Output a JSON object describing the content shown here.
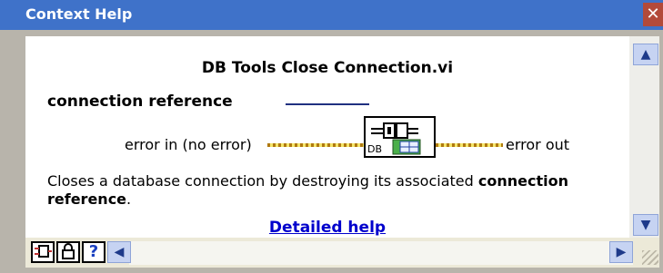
{
  "window": {
    "title": "Context Help",
    "close_glyph": "✕"
  },
  "content": {
    "heading": "DB Tools Close Connection.vi",
    "terminals": {
      "connection_reference": "connection reference",
      "error_in": "error in (no error)",
      "error_out": "error out"
    },
    "icon": {
      "label": "DB",
      "name": "database-close-vi-icon"
    },
    "description": {
      "prefix": "Closes a database connection by destroying its associated ",
      "bold": "connection reference",
      "suffix": "."
    },
    "link": "Detailed help"
  },
  "toolbar": {
    "buttons": [
      {
        "name": "show-optional-terminals-button",
        "icon": "terminal-icon"
      },
      {
        "name": "lock-button",
        "icon": "lock-icon"
      },
      {
        "name": "help-button",
        "label": "?"
      }
    ]
  },
  "colors": {
    "title_bar": "#3f72c9",
    "link": "#0000cc",
    "error_wire": "#c9a21b"
  }
}
